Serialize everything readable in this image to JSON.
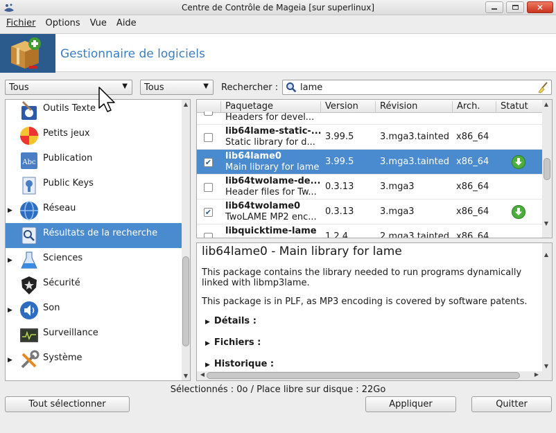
{
  "window": {
    "title": "Centre de Contrôle de Mageia  [sur superlinux]"
  },
  "menu": [
    "Fichier",
    "Options",
    "Vue",
    "Aide"
  ],
  "banner": {
    "title": "Gestionnaire de logiciels"
  },
  "filters": {
    "filter1": "Tous",
    "filter2": "Tous",
    "search_label": "Rechercher :",
    "search_value": "lame"
  },
  "categories": [
    {
      "label": "Outils Texte",
      "expandable": false,
      "selected": false
    },
    {
      "label": "Petits jeux",
      "expandable": false,
      "selected": false
    },
    {
      "label": "Publication",
      "expandable": false,
      "selected": false
    },
    {
      "label": "Public Keys",
      "expandable": false,
      "selected": false
    },
    {
      "label": "Réseau",
      "expandable": true,
      "selected": false
    },
    {
      "label": "Résultats de la recherche",
      "expandable": false,
      "selected": true
    },
    {
      "label": "Sciences",
      "expandable": true,
      "selected": false
    },
    {
      "label": "Sécurité",
      "expandable": false,
      "selected": false
    },
    {
      "label": "Son",
      "expandable": true,
      "selected": false
    },
    {
      "label": "Surveillance",
      "expandable": false,
      "selected": false
    },
    {
      "label": "Système",
      "expandable": true,
      "selected": false
    }
  ],
  "table": {
    "headers": [
      "Paquetage",
      "Version",
      "Révision",
      "Arch.",
      "Statut"
    ],
    "rows": [
      {
        "name": "",
        "desc": "Headers for devel...",
        "version": "",
        "revision": "",
        "arch": "",
        "checked": false,
        "status": false,
        "selected": false
      },
      {
        "name": "lib64lame-static-...",
        "desc": "Static library for d...",
        "version": "3.99.5",
        "revision": "3.mga3.tainted",
        "arch": "x86_64",
        "checked": false,
        "status": false,
        "selected": false
      },
      {
        "name": "lib64lame0",
        "desc": "Main library for lame",
        "version": "3.99.5",
        "revision": "3.mga3.tainted",
        "arch": "x86_64",
        "checked": true,
        "status": true,
        "selected": true
      },
      {
        "name": "lib64twolame-de...",
        "desc": "Header files for Tw...",
        "version": "0.3.13",
        "revision": "3.mga3",
        "arch": "x86_64",
        "checked": false,
        "status": false,
        "selected": false
      },
      {
        "name": "lib64twolame0",
        "desc": "TwoLAME MP2 enc...",
        "version": "0.3.13",
        "revision": "3.mga3",
        "arch": "x86_64",
        "checked": true,
        "status": true,
        "selected": false
      },
      {
        "name": "libquicktime-lame",
        "desc": "",
        "version": "1.2.4",
        "revision": "2.mga3.tainted",
        "arch": "x86_64",
        "checked": false,
        "status": false,
        "selected": false
      }
    ]
  },
  "description": {
    "title": "lib64lame0 - Main library for lame",
    "p1": "This package contains the library needed to run programs dynamically linked with libmp3lame.",
    "p2": "This package is in PLF, as MP3 encoding is covered by software patents.",
    "sections": [
      "Détails :",
      "Fichiers :",
      "Historique :"
    ]
  },
  "status_text": "Sélectionnés : 0o / Place libre sur disque : 22Go",
  "buttons": {
    "select_all": "Tout sélectionner",
    "apply": "Appliquer",
    "quit": "Quitter"
  },
  "colors": {
    "selection": "#4a8bd0",
    "banner_title": "#3c7dc0",
    "install_green": "#4caf3c"
  }
}
